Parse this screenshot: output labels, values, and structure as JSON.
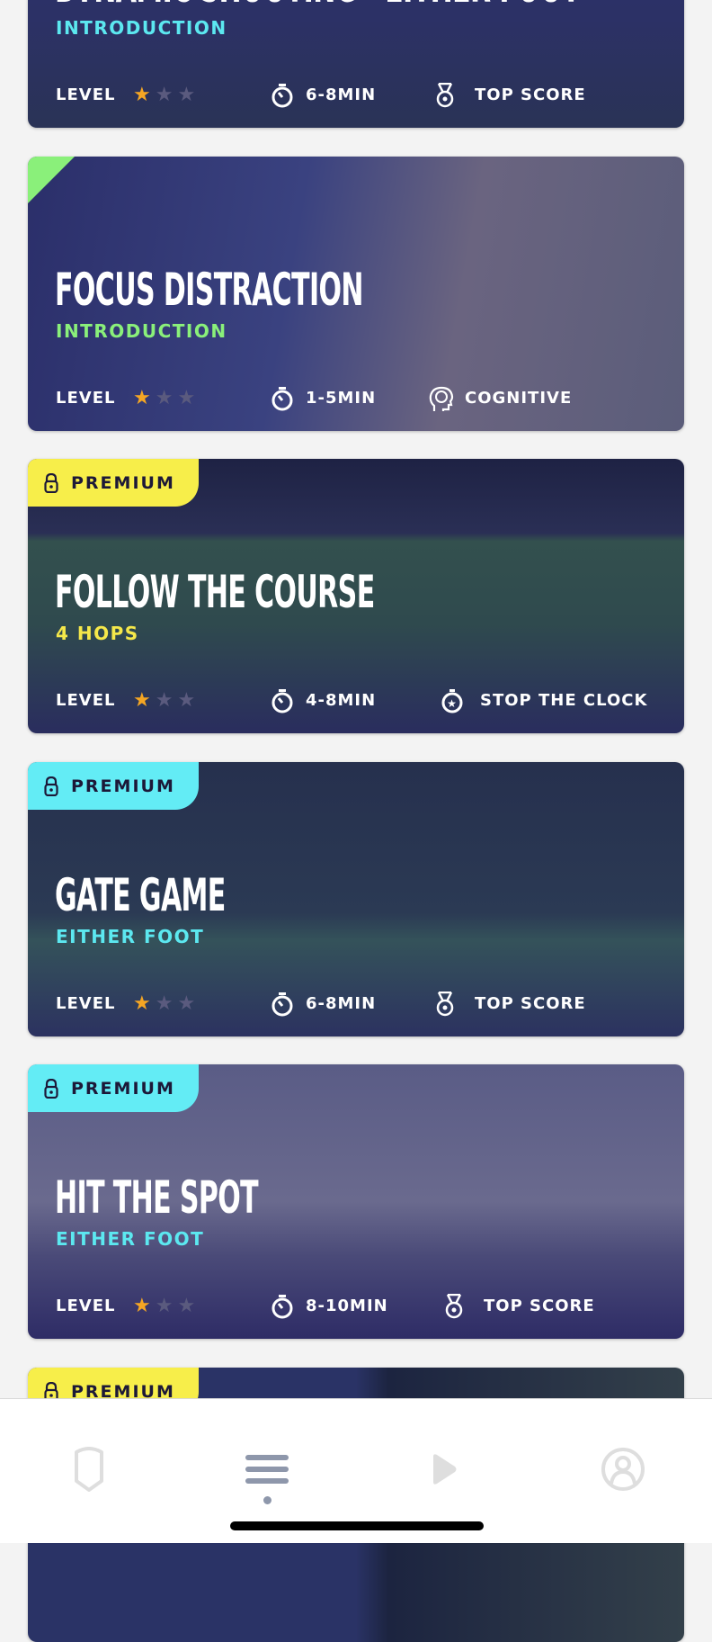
{
  "cards": [
    {
      "title": "DYNAMIC SHOOTING - EITHER FOOT",
      "subtitle": "INTRODUCTION",
      "subtitle_color": "#5ce8f0",
      "level_label": "LEVEL",
      "level": 1,
      "level_max": 3,
      "duration": "6-8MIN",
      "mode": "TOP SCORE",
      "mode_icon": "medal-icon",
      "badge": null,
      "bg": "linear-gradient(180deg,#2a2f6e 0%,#2c3166 60%,#2a3356 100%)"
    },
    {
      "title": "FOCUS DISTRACTION",
      "subtitle": "INTRODUCTION",
      "subtitle_color": "#8af07a",
      "level_label": "LEVEL",
      "level": 1,
      "level_max": 3,
      "duration": "1-5MIN",
      "mode": "COGNITIVE",
      "mode_icon": "brain-icon",
      "badge": null,
      "corner": "#8af07a",
      "bg": "linear-gradient(100deg,#2b2f6a 0%,#3a4280 40%,#6a6480 65%,#5b5d7a 100%)"
    },
    {
      "title": "FOLLOW THE COURSE",
      "subtitle": "4 HOPS",
      "subtitle_color": "#f5e84a",
      "level_label": "LEVEL",
      "level": 1,
      "level_max": 3,
      "duration": "4-8MIN",
      "mode": "STOP THE CLOCK",
      "mode_icon": "stopwatch-star-icon",
      "badge": "PREMIUM",
      "badge_color": "#f7ee4a",
      "bg": "linear-gradient(180deg,#1e2244 0%,#2a2f55 27%,#33504e 30%,#2f4a4e 60%,#2a2d5e 100%)"
    },
    {
      "title": "GATE GAME",
      "subtitle": "EITHER FOOT",
      "subtitle_color": "#5ce8f0",
      "level_label": "LEVEL",
      "level": 1,
      "level_max": 3,
      "duration": "6-8MIN",
      "mode": "TOP SCORE",
      "mode_icon": "medal-icon",
      "badge": "PREMIUM",
      "badge_color": "#63ecf5",
      "bg": "linear-gradient(180deg,#26304e 0%,#2b3a54 55%,#34525a 65%,#2c3260 100%)"
    },
    {
      "title": "HIT THE SPOT",
      "subtitle": "EITHER FOOT",
      "subtitle_color": "#5ce8f0",
      "level_label": "LEVEL",
      "level": 1,
      "level_max": 3,
      "duration": "8-10MIN",
      "mode": "TOP SCORE",
      "mode_icon": "medal-icon",
      "badge": "PREMIUM",
      "badge_color": "#63ecf5",
      "bg": "linear-gradient(180deg,#5a5c86 0%,#6a6a8e 50%,#4a4a78 70%,#2e2c66 100%)"
    },
    {
      "title": "",
      "subtitle": "",
      "badge": "PREMIUM",
      "badge_color": "#f7ee4a",
      "bg": "linear-gradient(90deg,#2a3366 0%,#2a3366 50%,#1c2440 55%,#33404a 100%)"
    }
  ],
  "colors": {
    "star_on": "#f5a623",
    "star_off": "#5a5a7e",
    "tab_active": "#8e97ab",
    "tab_inactive": "#dedede"
  },
  "tabbar": {
    "items": [
      {
        "icon": "shield-icon"
      },
      {
        "icon": "menu-icon",
        "active": true
      },
      {
        "icon": "play-icon"
      },
      {
        "icon": "profile-icon"
      }
    ]
  }
}
